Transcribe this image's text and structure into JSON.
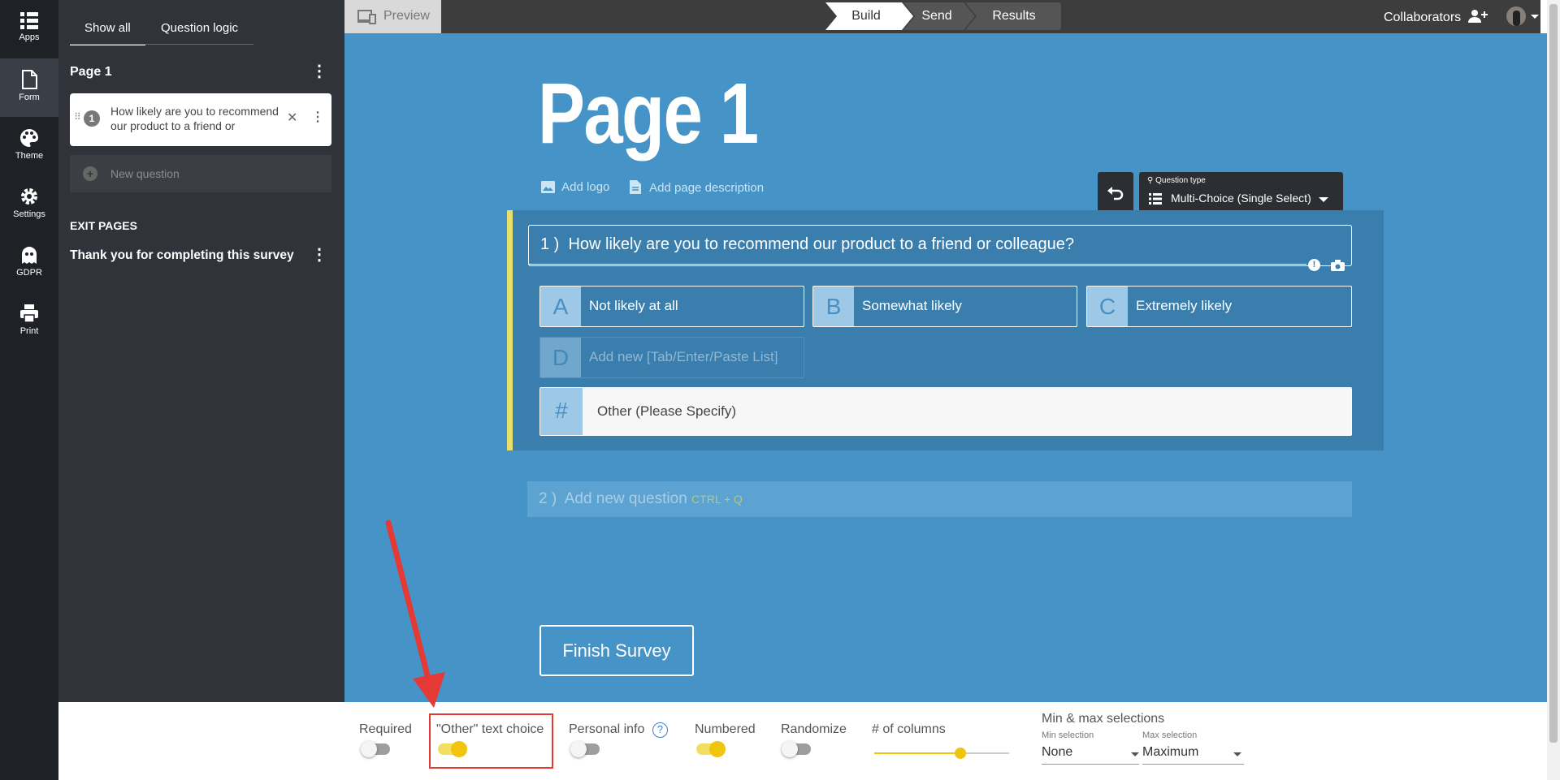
{
  "rail": {
    "items": [
      {
        "label": "Apps",
        "icon": "apps-grid-icon"
      },
      {
        "label": "Form",
        "icon": "form-document-icon"
      },
      {
        "label": "Theme",
        "icon": "palette-icon"
      },
      {
        "label": "Settings",
        "icon": "gear-icon"
      },
      {
        "label": "GDPR",
        "icon": "ghost-icon"
      },
      {
        "label": "Print",
        "icon": "printer-icon"
      }
    ],
    "active": "Form"
  },
  "sidebar": {
    "tabs": [
      "Show all",
      "Question logic"
    ],
    "page_heading": "Page 1",
    "question_card": {
      "number": "1",
      "text": "How likely are you to recommend our product to a friend or colleague?"
    },
    "new_question": "New question",
    "exit_heading": "EXIT PAGES",
    "exit_page": "Thank you for completing this survey"
  },
  "topbar": {
    "preview": "Preview",
    "steps": [
      "Build",
      "Send",
      "Results"
    ],
    "active_step": "Build",
    "collaborators": "Collaborators"
  },
  "canvas": {
    "page_title": "Page 1",
    "add_logo": "Add logo",
    "add_description": "Add page description",
    "question_type_label": "Question type",
    "question_type_value": "Multi-Choice (Single Select)",
    "question": {
      "prefix": "1 )",
      "text": "How likely are you to recommend our product to a friend or colleague?",
      "choices": [
        {
          "letter": "A",
          "text": "Not likely at all"
        },
        {
          "letter": "B",
          "text": "Somewhat likely"
        },
        {
          "letter": "C",
          "text": "Extremely likely"
        }
      ],
      "new_choice": {
        "letter": "D",
        "placeholder": "Add new [Tab/Enter/Paste List]"
      },
      "other": {
        "letter": "#",
        "text": "Other (Please Specify)"
      }
    },
    "next_question": {
      "prefix": "2 )",
      "text": "Add new question",
      "shortcut": "CTRL + Q"
    },
    "finish_button": "Finish Survey"
  },
  "bottom": {
    "required": {
      "label": "Required",
      "on": false
    },
    "other_text": {
      "label": "\"Other\" text choice",
      "on": true
    },
    "personal_info": {
      "label": "Personal info",
      "help": "?",
      "on": false
    },
    "numbered": {
      "label": "Numbered",
      "on": true
    },
    "randomize": {
      "label": "Randomize",
      "on": false
    },
    "columns": {
      "label": "# of columns",
      "value": 0.64
    },
    "minmax": {
      "label": "Min & max selections",
      "min_label": "Min selection",
      "min_value": "None",
      "max_label": "Max selection",
      "max_value": "Maximum"
    }
  },
  "colors": {
    "accent": "#f1c40f",
    "canvas": "#4593c7",
    "highlight": "#e53935"
  }
}
